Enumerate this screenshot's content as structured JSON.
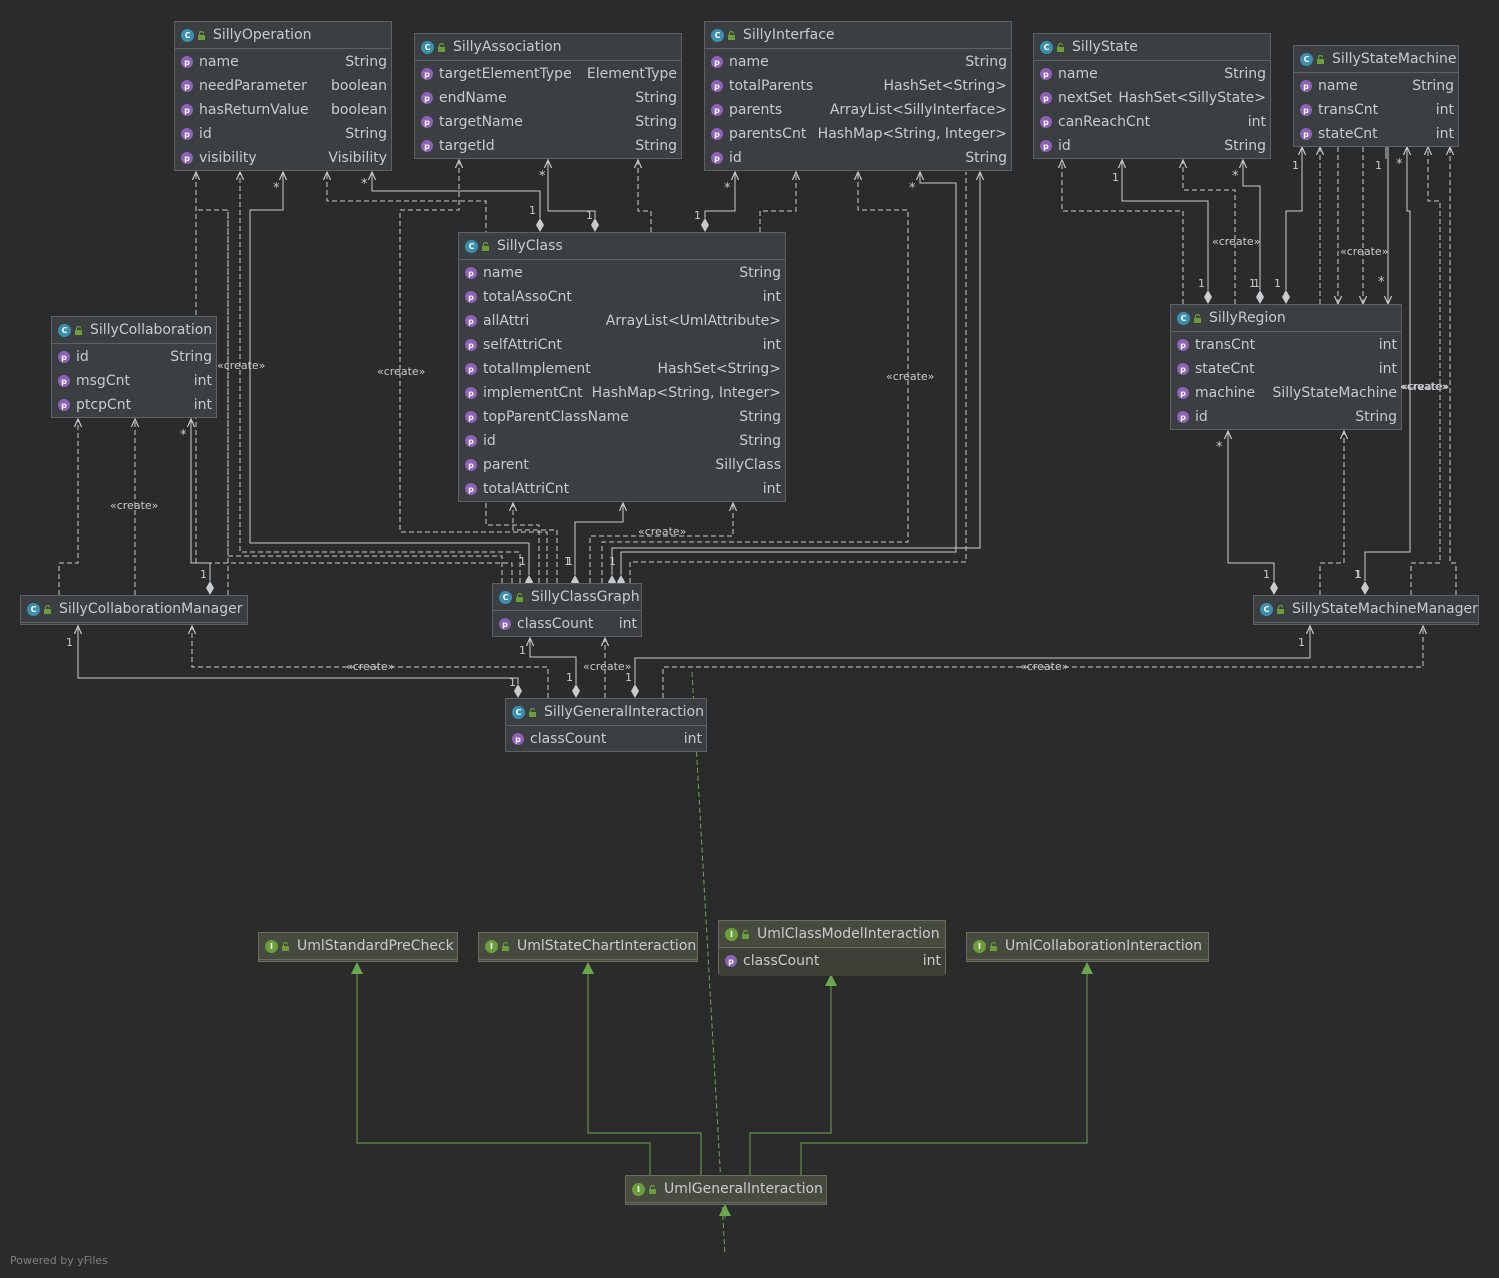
{
  "nodes": {
    "SillyOperation": {
      "title": "SillyOperation",
      "kind": "class",
      "fields": [
        {
          "name": "name",
          "type": "String"
        },
        {
          "name": "needParameter",
          "type": "boolean"
        },
        {
          "name": "hasReturnValue",
          "type": "boolean"
        },
        {
          "name": "id",
          "type": "String"
        },
        {
          "name": "visibility",
          "type": "Visibility"
        }
      ]
    },
    "SillyAssociation": {
      "title": "SillyAssociation",
      "kind": "class",
      "fields": [
        {
          "name": "targetElementType",
          "type": "ElementType"
        },
        {
          "name": "endName",
          "type": "String"
        },
        {
          "name": "targetName",
          "type": "String"
        },
        {
          "name": "targetId",
          "type": "String"
        }
      ]
    },
    "SillyInterface": {
      "title": "SillyInterface",
      "kind": "class",
      "fields": [
        {
          "name": "name",
          "type": "String"
        },
        {
          "name": "totalParents",
          "type": "HashSet<String>"
        },
        {
          "name": "parents",
          "type": "ArrayList<SillyInterface>"
        },
        {
          "name": "parentsCnt",
          "type": "HashMap<String, Integer>"
        },
        {
          "name": "id",
          "type": "String"
        }
      ]
    },
    "SillyState": {
      "title": "SillyState",
      "kind": "class",
      "fields": [
        {
          "name": "name",
          "type": "String"
        },
        {
          "name": "nextSet",
          "type": "HashSet<SillyState>"
        },
        {
          "name": "canReachCnt",
          "type": "int"
        },
        {
          "name": "id",
          "type": "String"
        }
      ]
    },
    "SillyStateMachine": {
      "title": "SillyStateMachine",
      "kind": "class",
      "fields": [
        {
          "name": "name",
          "type": "String"
        },
        {
          "name": "transCnt",
          "type": "int"
        },
        {
          "name": "stateCnt",
          "type": "int"
        }
      ]
    },
    "SillyClass": {
      "title": "SillyClass",
      "kind": "class",
      "fields": [
        {
          "name": "name",
          "type": "String"
        },
        {
          "name": "totalAssoCnt",
          "type": "int"
        },
        {
          "name": "allAttri",
          "type": "ArrayList<UmlAttribute>"
        },
        {
          "name": "selfAttriCnt",
          "type": "int"
        },
        {
          "name": "totalImplement",
          "type": "HashSet<String>"
        },
        {
          "name": "implementCnt",
          "type": "HashMap<String, Integer>"
        },
        {
          "name": "topParentClassName",
          "type": "String"
        },
        {
          "name": "id",
          "type": "String"
        },
        {
          "name": "parent",
          "type": "SillyClass"
        },
        {
          "name": "totalAttriCnt",
          "type": "int"
        }
      ]
    },
    "SillyCollaboration": {
      "title": "SillyCollaboration",
      "kind": "class",
      "fields": [
        {
          "name": "id",
          "type": "String"
        },
        {
          "name": "msgCnt",
          "type": "int"
        },
        {
          "name": "ptcpCnt",
          "type": "int"
        }
      ]
    },
    "SillyRegion": {
      "title": "SillyRegion",
      "kind": "class",
      "fields": [
        {
          "name": "transCnt",
          "type": "int"
        },
        {
          "name": "stateCnt",
          "type": "int"
        },
        {
          "name": "machine",
          "type": "SillyStateMachine"
        },
        {
          "name": "id",
          "type": "String"
        }
      ]
    },
    "SillyCollaborationManager": {
      "title": "SillyCollaborationManager",
      "kind": "class",
      "fields": []
    },
    "SillyClassGraph": {
      "title": "SillyClassGraph",
      "kind": "class",
      "fields": [
        {
          "name": "classCount",
          "type": "int"
        }
      ]
    },
    "SillyStateMachineManager": {
      "title": "SillyStateMachineManager",
      "kind": "class",
      "fields": []
    },
    "SillyGeneralInteraction": {
      "title": "SillyGeneralInteraction",
      "kind": "class",
      "fields": [
        {
          "name": "classCount",
          "type": "int"
        }
      ]
    },
    "UmlStandardPreCheck": {
      "title": "UmlStandardPreCheck",
      "kind": "interface",
      "fields": []
    },
    "UmlStateChartInteraction": {
      "title": "UmlStateChartInteraction",
      "kind": "interface",
      "fields": []
    },
    "UmlClassModelInteraction": {
      "title": "UmlClassModelInteraction",
      "kind": "interface",
      "fields": [
        {
          "name": "classCount",
          "type": "int"
        }
      ]
    },
    "UmlCollaborationInteraction": {
      "title": "UmlCollaborationInteraction",
      "kind": "interface",
      "fields": []
    },
    "UmlGeneralInteraction": {
      "title": "UmlGeneralInteraction",
      "kind": "interface",
      "fields": []
    }
  },
  "badges": {
    "class": "C",
    "interface": "I",
    "property": "p"
  },
  "labels": [
    "«create»",
    "«create»",
    "«create»",
    "«create»",
    "«create»",
    "«create»",
    "«create»",
    "«create»",
    "«create»",
    "«create»",
    "«create»",
    "«create»",
    "1",
    "1",
    "1",
    "1",
    "1",
    "1",
    "1",
    "1",
    "1",
    "1",
    "1",
    "1",
    "1",
    "1",
    "1",
    "1",
    "1",
    "1",
    "1",
    "1",
    "1",
    "1",
    "1",
    "1",
    "*",
    "*",
    "*",
    "*",
    "*",
    "*",
    "*",
    "*",
    "*",
    "*"
  ],
  "footer": "Powered by yFiles",
  "colors": {
    "background": "#2b2b2b",
    "line": "#c8cbce",
    "realization": "#6aa84f",
    "classBadge": "#3b8fb1",
    "interfaceBadge": "#6a9e3b",
    "propertyBadge": "#8e61b8"
  }
}
